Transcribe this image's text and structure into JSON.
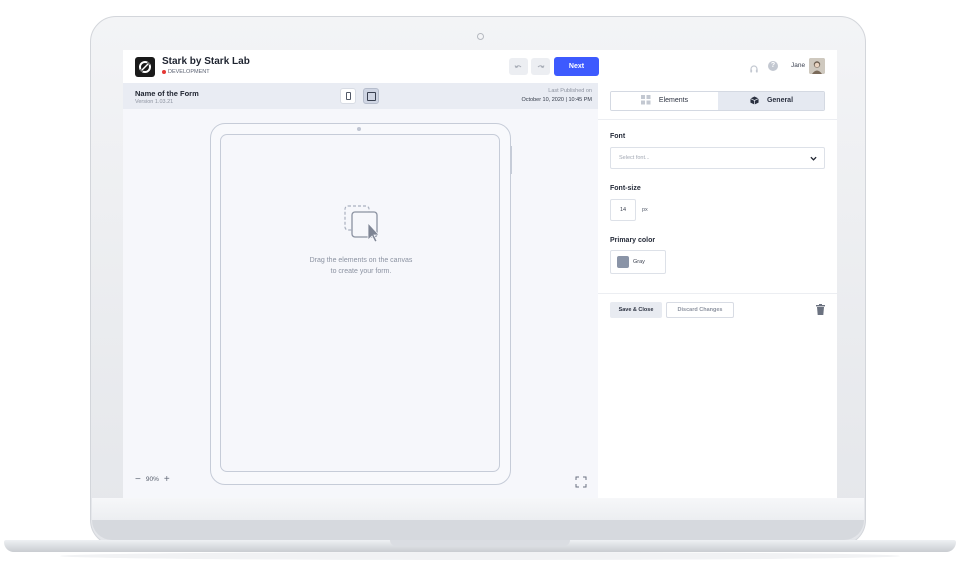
{
  "app": {
    "brand_title": "Stark by Stark Lab",
    "environment": "DEVELOPMENT"
  },
  "toolbar": {
    "undo_icon": "undo-icon",
    "redo_icon": "redo-icon",
    "next_label": "Next",
    "accent_color": "#3d5afe"
  },
  "user": {
    "name": "Jane",
    "help_label": "?"
  },
  "form": {
    "name": "Name of the Form",
    "version": "Version 1.03.21",
    "published_label": "Last Published on",
    "published_date": "October 10, 2020 | 10:45 PM"
  },
  "canvas": {
    "empty_line1": "Drag the elements on the canvas",
    "empty_line2": "to create your form.",
    "zoom_minus": "−",
    "zoom_value": "90%",
    "zoom_plus": "+"
  },
  "panel": {
    "tab_elements": "Elements",
    "tab_general": "General",
    "font_label": "Font",
    "font_placeholder": "Select font...",
    "font_size_label": "Font-size",
    "font_size_value": "14",
    "font_size_unit": "px",
    "primary_color_label": "Primary color",
    "primary_color_name": "Gray",
    "primary_color_value": "#8a94a7",
    "save_label": "Save & Close",
    "discard_label": "Discard Changes"
  }
}
